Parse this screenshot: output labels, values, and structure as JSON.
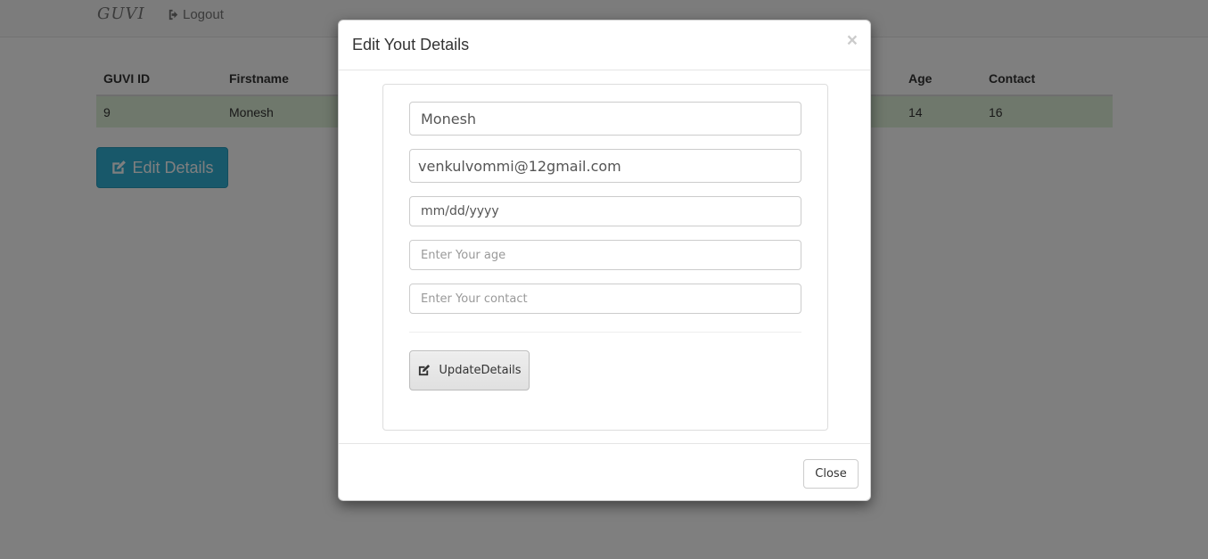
{
  "navbar": {
    "brand": "GUVI",
    "logout_label": "Logout"
  },
  "table": {
    "headers": [
      "GUVI ID",
      "Firstname",
      "Age",
      "Contact"
    ],
    "row": {
      "id": "9",
      "firstname": "Monesh",
      "age": "14",
      "contact": "16"
    }
  },
  "edit_button": {
    "label": "Edit Details",
    "color": "#31b0d5"
  },
  "modal": {
    "title": "Edit Yout Details",
    "close_symbol": "×",
    "fields": {
      "name_value": "Monesh",
      "email_value": "venkulvommi@12gmail.com",
      "date_placeholder": "mm/dd/yyyy",
      "age_placeholder": "Enter Your age",
      "contact_placeholder": "Enter Your contact"
    },
    "update_label": "UpdateDetails",
    "close_label": "Close"
  }
}
